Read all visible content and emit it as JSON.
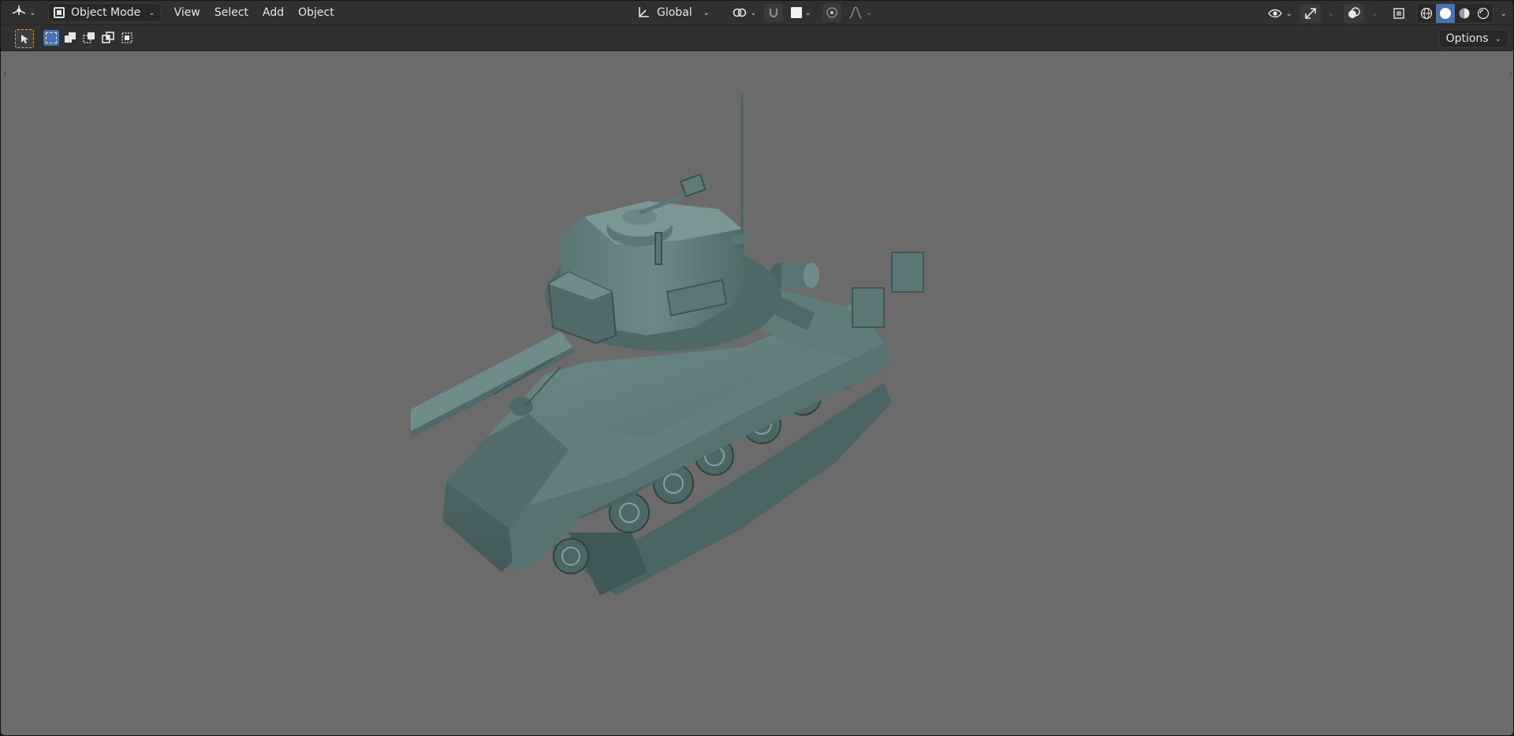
{
  "header": {
    "editor_type_icon": "viewport-editor-icon",
    "mode_select": {
      "value": "Object Mode",
      "icon": "object-mode-icon"
    },
    "menus": [
      "View",
      "Select",
      "Add",
      "Object"
    ],
    "transform_orientation": {
      "value": "Global",
      "icon": "orientation-axes-icon"
    },
    "pivot_icon": "pivot-point-icon",
    "snap_icon": "snap-magnet-icon",
    "snap_target_icon": "snap-target-icon",
    "proportional_icon": "proportional-editing-icon",
    "falloff_icon": "falloff-curve-icon",
    "visibility_icon": "visibility-eye-icon",
    "gizmo_icon": "gizmo-icon",
    "overlay_icon": "overlay-icon",
    "xray_icon": "xray-icon",
    "shading_modes": [
      {
        "name": "wireframe",
        "active": false
      },
      {
        "name": "solid",
        "active": true
      },
      {
        "name": "material-preview",
        "active": false
      },
      {
        "name": "rendered",
        "active": false
      }
    ]
  },
  "toolheader": {
    "active_tool_icon": "select-box-tool-icon",
    "selection_modes": [
      "set-new",
      "extend",
      "subtract",
      "invert",
      "intersect"
    ],
    "options_label": "Options"
  },
  "viewport": {
    "background_color": "#6b6b6b",
    "object": "Sherman tank model (solid shading)",
    "model_color": "#5f7a79"
  },
  "colors": {
    "accent": "#4772b3",
    "active_tool_outline": "#e4a33a",
    "header_bg": "#303030"
  }
}
